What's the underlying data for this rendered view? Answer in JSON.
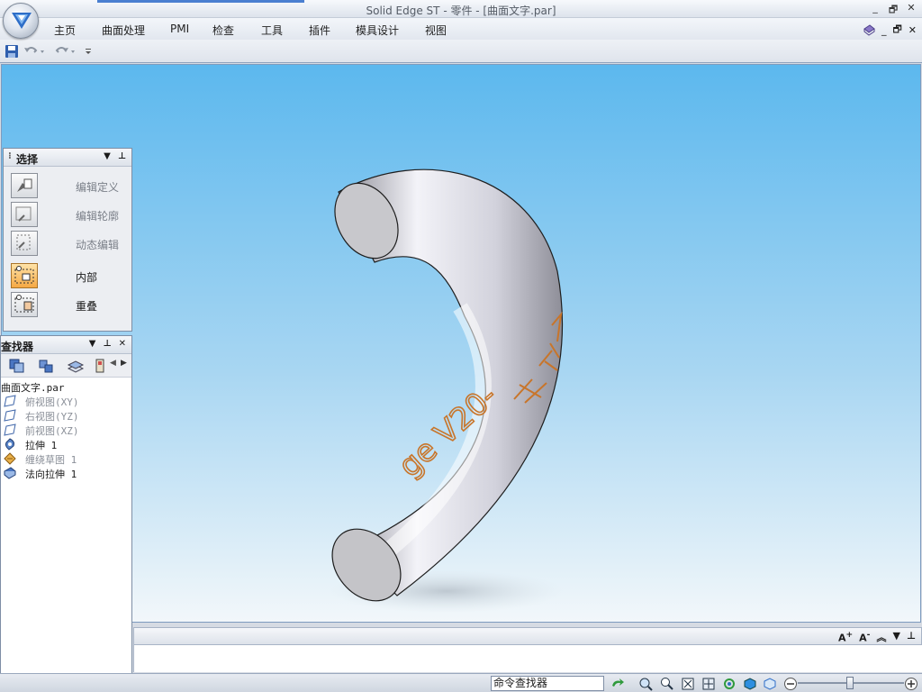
{
  "window": {
    "title": "Solid Edge ST - 零件 - [曲面文字.par]",
    "controls": [
      "_",
      "🗗",
      "✕"
    ]
  },
  "ribbon": {
    "tabs": [
      "主页",
      "曲面处理",
      "PMI",
      "检查",
      "工具",
      "插件",
      "模具设计",
      "视图"
    ],
    "right_controls": [
      "_",
      "🗗",
      "✕"
    ]
  },
  "qat": {
    "items": [
      "save-icon",
      "undo-icon",
      "redo-icon",
      "customize-icon"
    ]
  },
  "select_panel": {
    "title": "选择",
    "items": [
      {
        "label": "编辑定义",
        "enabled": false,
        "active": false,
        "icon": "edit-definition-icon"
      },
      {
        "label": "编辑轮廓",
        "enabled": false,
        "active": false,
        "icon": "edit-profile-icon"
      },
      {
        "label": "动态编辑",
        "enabled": false,
        "active": false,
        "icon": "dynamic-edit-icon"
      },
      {
        "label": "内部",
        "enabled": true,
        "active": true,
        "icon": "inside-select-icon"
      },
      {
        "label": "重叠",
        "enabled": true,
        "active": false,
        "icon": "overlap-select-icon"
      }
    ]
  },
  "finder_panel": {
    "title": "查找器",
    "tree": [
      {
        "label": "曲面文字.par",
        "dim": false,
        "icon": "part-file-icon"
      },
      {
        "label": "俯视图(XY)",
        "dim": true,
        "icon": "plane-icon"
      },
      {
        "label": "右视图(YZ)",
        "dim": true,
        "icon": "plane-icon"
      },
      {
        "label": "前视图(XZ)",
        "dim": true,
        "icon": "plane-icon"
      },
      {
        "label": "拉伸 1",
        "dim": false,
        "icon": "extrude-icon"
      },
      {
        "label": "缠绕草图 1",
        "dim": true,
        "icon": "wrap-sketch-icon"
      },
      {
        "label": "法向拉伸 1",
        "dim": false,
        "icon": "normal-extrude-icon"
      }
    ]
  },
  "model": {
    "embossed_text": "ge V20-"
  },
  "status": {
    "command_finder": "命令查找器"
  },
  "colors": {
    "viewport_top": "#5cb8ee",
    "viewport_bottom": "#f2f7fa",
    "active_highlight": "#f5a844",
    "emboss_text": "#c8752a"
  }
}
